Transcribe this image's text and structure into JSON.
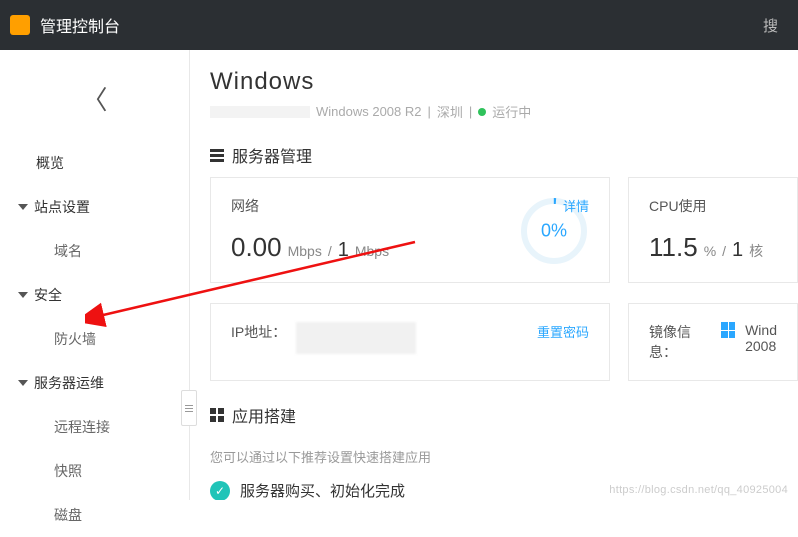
{
  "topbar": {
    "title": "管理控制台",
    "search_hint": "搜"
  },
  "sidebar": {
    "overview": "概览",
    "site_group": "站点设置",
    "domain": "域名",
    "security_group": "安全",
    "firewall": "防火墙",
    "ops_group": "服务器运维",
    "remote": "远程连接",
    "snapshot": "快照",
    "disk": "磁盘"
  },
  "header": {
    "title": "Windows",
    "os_fragment": "Windows 2008 R2",
    "region": "深圳",
    "status": "运行中"
  },
  "server_mgmt": {
    "title": "服务器管理",
    "network": {
      "title": "网络",
      "detail_link": "详情",
      "value": "0.00",
      "unit1": "Mbps",
      "sep": "/",
      "cap": "1",
      "unit2": "Mbps",
      "gauge": "0%"
    },
    "cpu": {
      "title": "CPU使用",
      "value": "11.5",
      "pct": "%",
      "sep": "/",
      "cores": "1",
      "core_unit": "核"
    },
    "ip": {
      "label": "IP地址：",
      "reset_link": "重置密码"
    },
    "image": {
      "label": "镜像信息：",
      "os_line1": "Wind",
      "os_line2": "2008"
    }
  },
  "app_build": {
    "title": "应用搭建",
    "desc": "您可以通过以下推荐设置快速搭建应用",
    "step1": "服务器购买、初始化完成"
  },
  "watermark": "https://blog.csdn.net/qq_40925004"
}
